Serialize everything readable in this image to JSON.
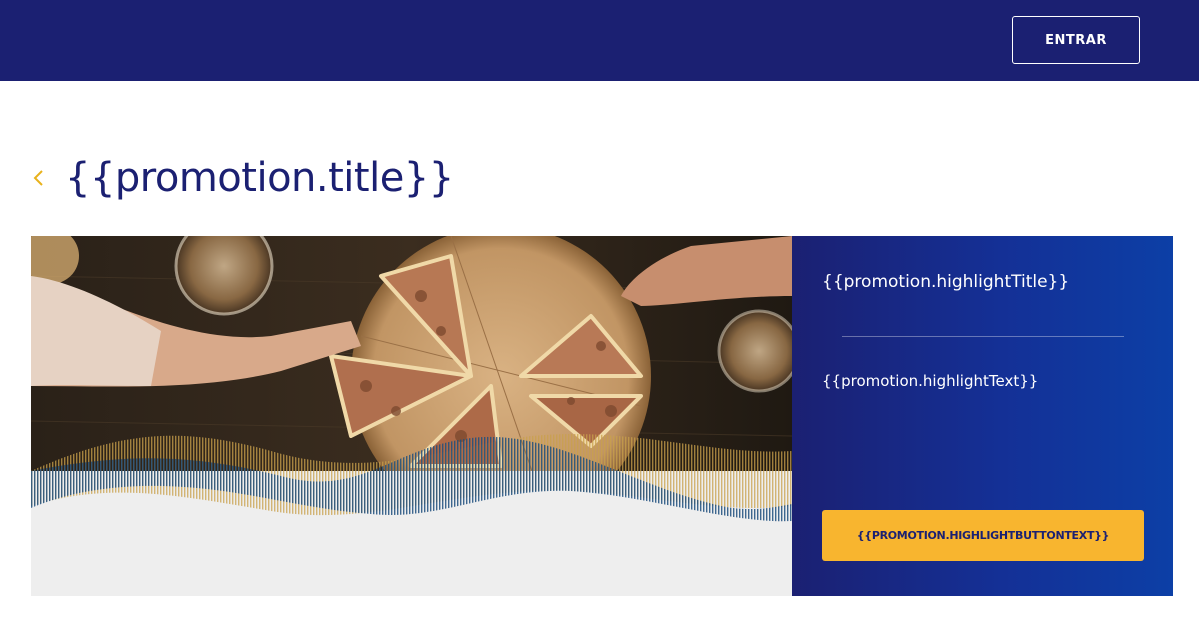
{
  "header": {
    "login_label": "ENTRAR"
  },
  "promotion": {
    "back_icon": "chevron-left-icon",
    "title": "{{promotion.title}}",
    "highlight_title": "{{promotion.highlightTitle}}",
    "highlight_text": "{{promotion.highlightText}}",
    "highlight_button_text": "{{PROMOTION.HIGHLIGHTBUTTONTEXT}}"
  },
  "colors": {
    "header_bg": "#1b2072",
    "accent": "#e8b21c",
    "button_bg": "#f8b52f",
    "panel_bg": "#143096"
  }
}
